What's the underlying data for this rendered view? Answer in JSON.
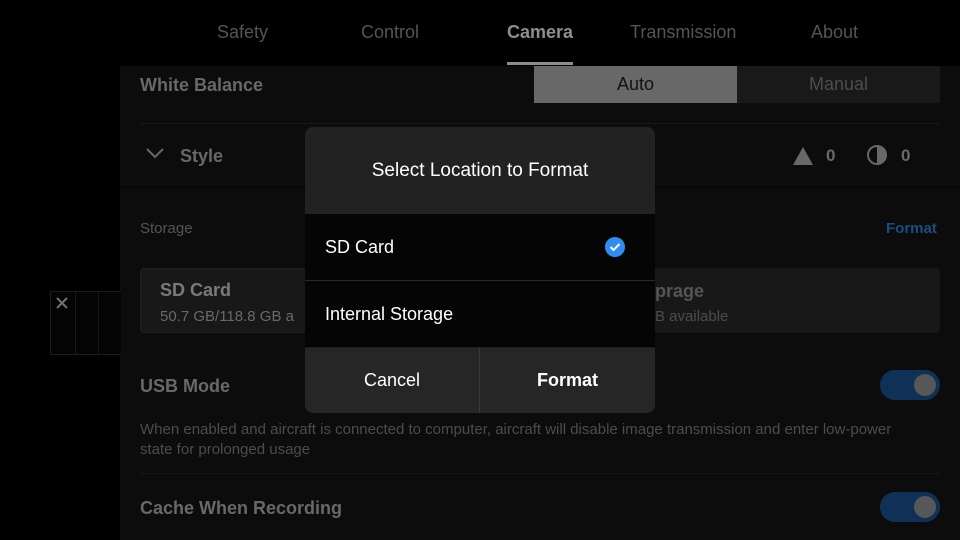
{
  "tabs": [
    {
      "label": "Safety"
    },
    {
      "label": "Control"
    },
    {
      "label": "Camera"
    },
    {
      "label": "Transmission"
    },
    {
      "label": "About"
    }
  ],
  "white_balance": {
    "label": "White Balance",
    "auto": "Auto",
    "manual": "Manual"
  },
  "style": {
    "label": "Style",
    "sharpness": "0",
    "contrast": "0"
  },
  "storage": {
    "label": "Storage",
    "format_link": "Format",
    "sd_card": {
      "name": "SD Card",
      "capacity": "50.7 GB/118.8 GB a"
    },
    "internal": {
      "name_partial": "prage",
      "capacity_partial": "B available"
    }
  },
  "usb_mode": {
    "label": "USB Mode",
    "description": "When enabled and aircraft is connected to computer, aircraft will disable image transmission and enter low-power state for prolonged usage"
  },
  "cache": {
    "label": "Cache When Recording"
  },
  "dialog": {
    "title": "Select Location to Format",
    "options": [
      {
        "label": "SD Card",
        "selected": true
      },
      {
        "label": "Internal Storage",
        "selected": false
      }
    ],
    "cancel": "Cancel",
    "format": "Format"
  },
  "colors": {
    "accent": "#2f8cf0",
    "toggle_on": "#1e5a9e"
  }
}
